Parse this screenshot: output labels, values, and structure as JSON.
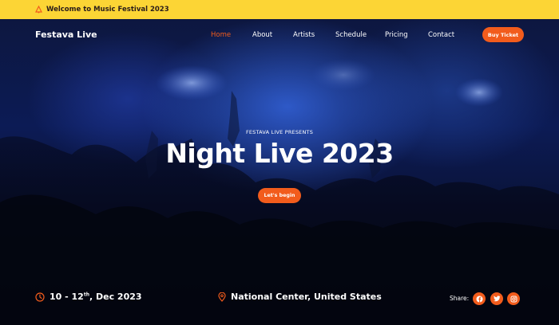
{
  "announcement": {
    "text": "Welcome to Music Festival 2023",
    "icon": "megaphone-icon"
  },
  "brand": {
    "name": "Festava Live"
  },
  "nav": {
    "home": "Home",
    "about": "About",
    "artists": "Artists",
    "schedule": "Schedule",
    "pricing": "Pricing",
    "contact": "Contact",
    "active": "Home"
  },
  "cta": {
    "buy_ticket": "Buy Ticket"
  },
  "hero": {
    "presents": "FESTAVA LIVE PRESENTS",
    "title": "Night Live 2023",
    "button": "Let's begin"
  },
  "event": {
    "date_start": "10 - 12",
    "date_sup": "th",
    "date_end": ", Dec 2023",
    "venue": "National Center, United States"
  },
  "share": {
    "label": "Share:",
    "icons": [
      "facebook-icon",
      "twitter-icon",
      "instagram-icon"
    ]
  },
  "colors": {
    "accent": "#f25c1c",
    "topbar": "#fcd535",
    "hero_blue": "#0c1b55"
  }
}
